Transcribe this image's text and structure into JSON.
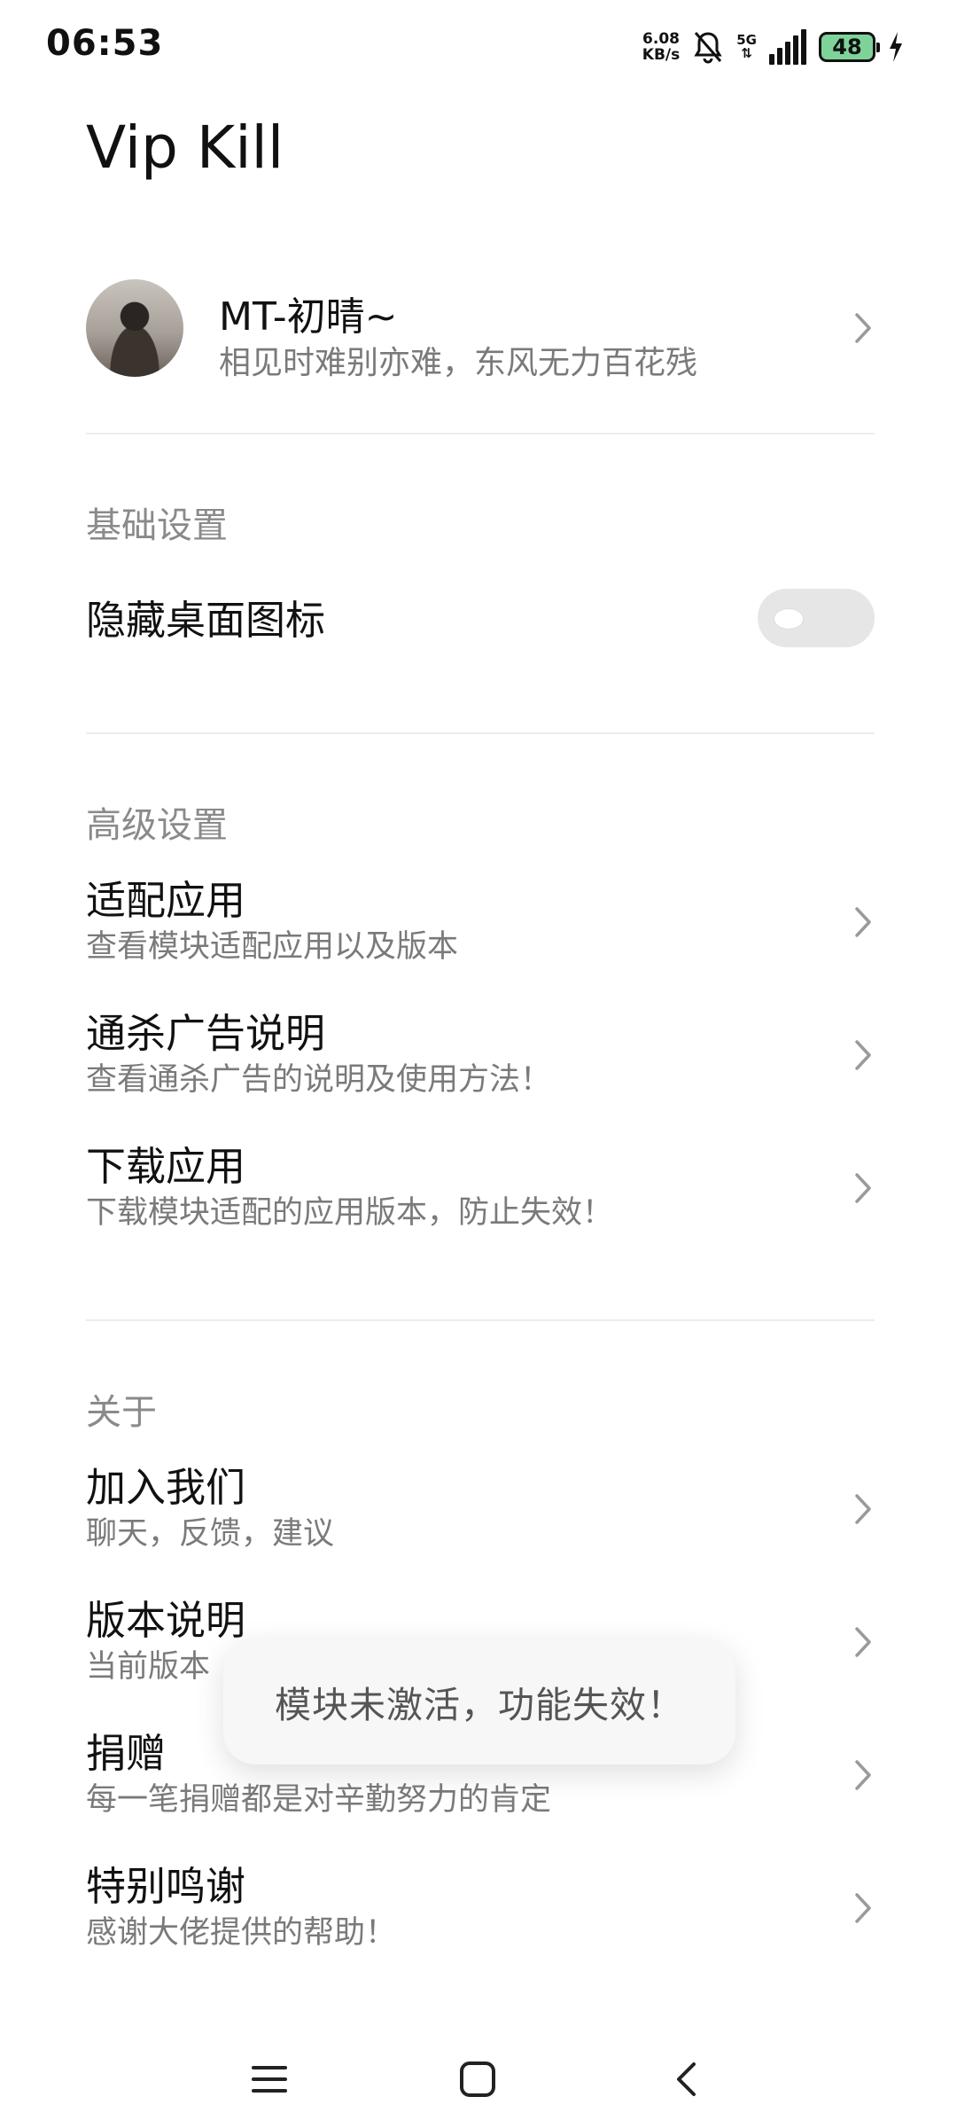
{
  "status_bar": {
    "time": "06:53",
    "net_speed_value": "6.08",
    "net_speed_unit": "KB/s",
    "network_gen": "5G",
    "battery_level": "48",
    "icons": [
      "bell-off-icon",
      "signal-icon",
      "battery-icon",
      "charging-bolt-icon"
    ]
  },
  "header": {
    "title": "Vip Kill"
  },
  "profile": {
    "name": "MT-初晴~",
    "motto": "相见时难别亦难，东风无力百花残"
  },
  "sections": {
    "basic": {
      "title": "基础设置",
      "hide_icon": {
        "label": "隐藏桌面图标",
        "enabled": false
      }
    },
    "advanced": {
      "title": "高级设置",
      "items": [
        {
          "title": "适配应用",
          "subtitle": "查看模块适配应用以及版本"
        },
        {
          "title": "通杀广告说明",
          "subtitle": "查看通杀广告的说明及使用方法！"
        },
        {
          "title": "下载应用",
          "subtitle": "下载模块适配的应用版本，防止失效！"
        }
      ]
    },
    "about": {
      "title": "关于",
      "items": [
        {
          "title": "加入我们",
          "subtitle": "聊天，反馈，建议"
        },
        {
          "title": "版本说明",
          "subtitle": "当前版本"
        },
        {
          "title": "捐赠",
          "subtitle": "每一笔捐赠都是对辛勤努力的肯定"
        },
        {
          "title": "特别鸣谢",
          "subtitle": "感谢大佬提供的帮助！"
        }
      ]
    }
  },
  "toast": {
    "message": "模块未激活，功能失效！"
  },
  "nav_bar": {
    "icons": [
      "menu-icon",
      "home-icon",
      "back-icon"
    ]
  }
}
